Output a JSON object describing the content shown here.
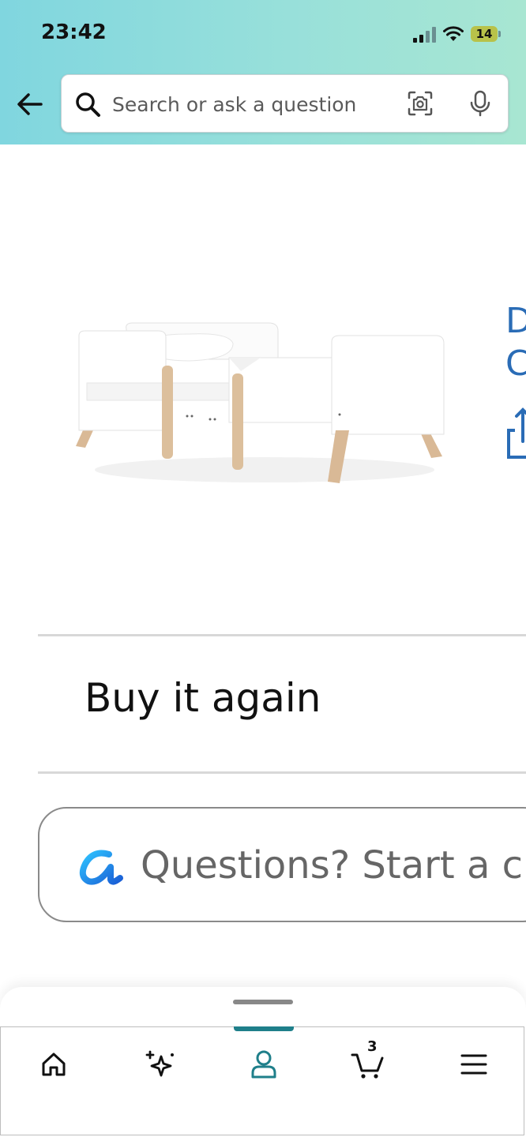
{
  "status_bar": {
    "time": "23:42",
    "battery": "14"
  },
  "search": {
    "placeholder": "Search or ask a question"
  },
  "product": {
    "side_text": "D\nC"
  },
  "sections": {
    "buy_again": "Buy it again"
  },
  "rufus": {
    "prompt": "Questions? Start a c"
  },
  "bottom_nav": {
    "items": [
      "home",
      "rufus",
      "account",
      "cart",
      "menu"
    ],
    "cart_count": "3",
    "active": "account"
  },
  "colors": {
    "header_gradient_start": "#80d6df",
    "header_gradient_end": "#a8e6d2",
    "link_blue": "#2a6cb6",
    "active_teal": "#1f7f8a"
  }
}
